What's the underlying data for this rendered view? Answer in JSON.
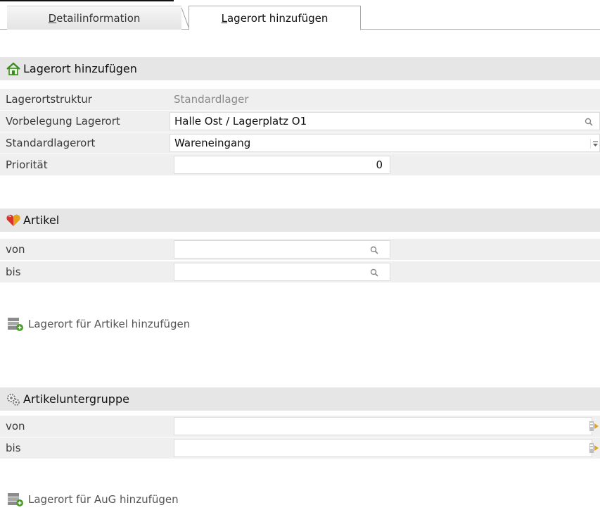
{
  "tabs": [
    {
      "label": "Detailinformation",
      "accel": "D",
      "rest": "etailinformation",
      "active": false
    },
    {
      "label": "Lagerort hinzufügen",
      "accel": "L",
      "rest": "agerort hinzufügen",
      "active": true
    }
  ],
  "section_lagerort": {
    "title": "Lagerort hinzufügen",
    "icon": "house-icon",
    "rows": {
      "struktur": {
        "label": "Lagerortstruktur",
        "value": "Standardlager"
      },
      "vorbelegung": {
        "label": "Vorbelegung Lagerort",
        "value": "Halle Ost / Lagerplatz O1"
      },
      "standard": {
        "label": "Standardlagerort",
        "value": "Wareneingang"
      },
      "prioritaet": {
        "label": "Priorität",
        "value": "0"
      }
    }
  },
  "section_artikel": {
    "title": "Artikel",
    "icon": "heart-icon",
    "von_label": "von",
    "bis_label": "bis",
    "action_label": "Lagerort für Artikel hinzufügen"
  },
  "section_aug": {
    "title": "Artikeluntergruppe",
    "icon": "gears-icon",
    "von_label": "von",
    "bis_label": "bis",
    "action_label": "Lagerort für AuG hinzufügen"
  },
  "colors": {
    "header_bg": "#e6e6e6",
    "row_bg": "#efefef",
    "accent_green": "#4a9a2a"
  }
}
